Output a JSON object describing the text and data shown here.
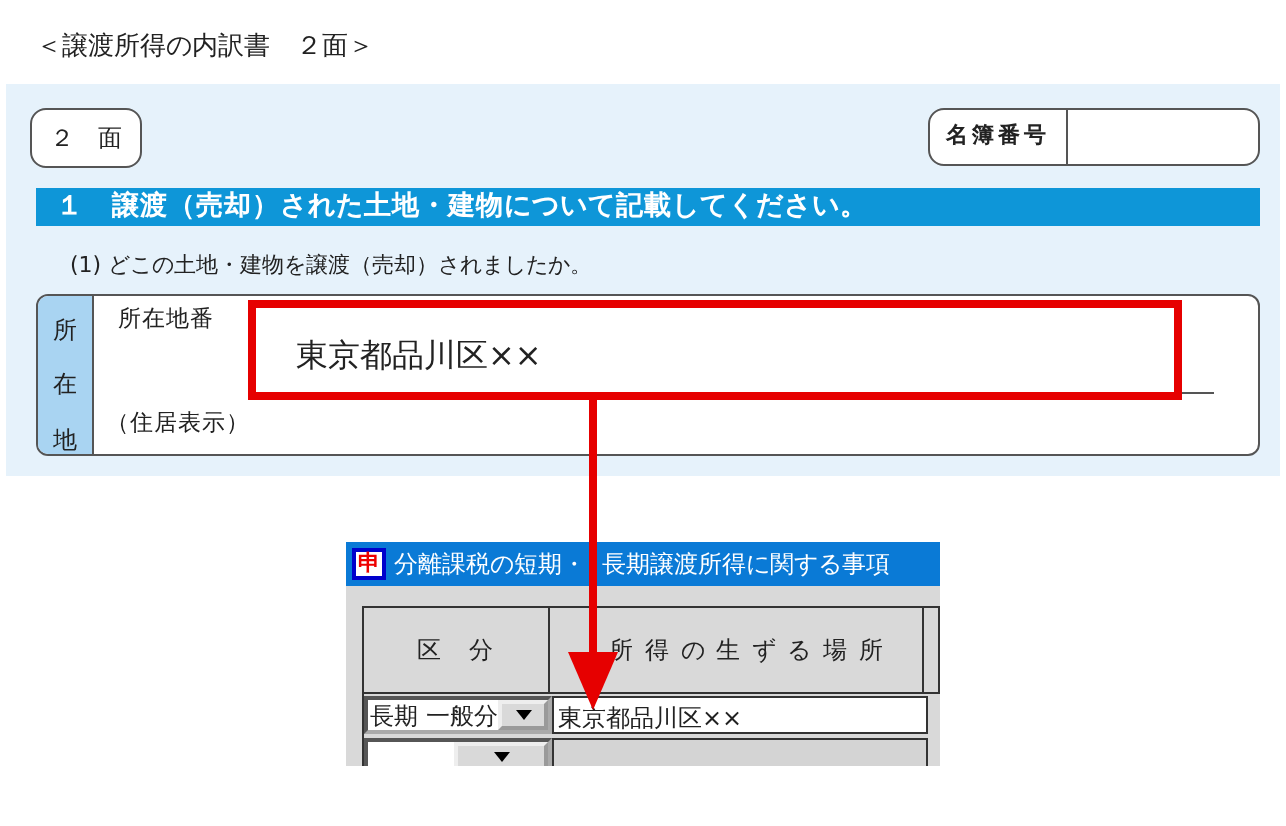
{
  "heading": "＜譲渡所得の内訳書　２面＞",
  "form": {
    "page_label": "２　面",
    "register_label": "名簿番号",
    "section_title": "１　譲渡（売却）された土地・建物について記載してください。",
    "question": "(1)  どこの土地・建物を譲渡（売却）されましたか。",
    "location_label": "所在地",
    "lot_label": "所在地番",
    "address_label": "（住居表示）"
  },
  "callout": {
    "text": "東京都品川区××"
  },
  "window": {
    "icon_glyph": "申",
    "title_parts": [
      "分離課税の短期・",
      "長期譲渡所得に関する事項"
    ],
    "columns": [
      "区　分",
      "所 得 の 生 ず る 場 所"
    ],
    "rows": [
      {
        "category": "長期 一般分",
        "place": "東京都品川区××",
        "disabled": false
      },
      {
        "disabled": true
      }
    ]
  }
}
